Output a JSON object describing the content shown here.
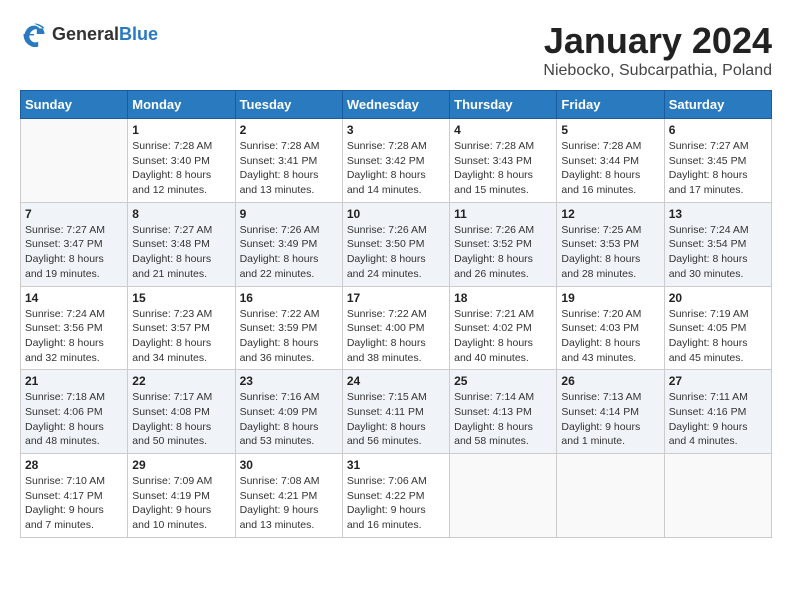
{
  "header": {
    "logo_general": "General",
    "logo_blue": "Blue",
    "month_title": "January 2024",
    "location": "Niebocko, Subcarpathia, Poland"
  },
  "weekdays": [
    "Sunday",
    "Monday",
    "Tuesday",
    "Wednesday",
    "Thursday",
    "Friday",
    "Saturday"
  ],
  "weeks": [
    [
      {
        "day": "",
        "info": ""
      },
      {
        "day": "1",
        "info": "Sunrise: 7:28 AM\nSunset: 3:40 PM\nDaylight: 8 hours\nand 12 minutes."
      },
      {
        "day": "2",
        "info": "Sunrise: 7:28 AM\nSunset: 3:41 PM\nDaylight: 8 hours\nand 13 minutes."
      },
      {
        "day": "3",
        "info": "Sunrise: 7:28 AM\nSunset: 3:42 PM\nDaylight: 8 hours\nand 14 minutes."
      },
      {
        "day": "4",
        "info": "Sunrise: 7:28 AM\nSunset: 3:43 PM\nDaylight: 8 hours\nand 15 minutes."
      },
      {
        "day": "5",
        "info": "Sunrise: 7:28 AM\nSunset: 3:44 PM\nDaylight: 8 hours\nand 16 minutes."
      },
      {
        "day": "6",
        "info": "Sunrise: 7:27 AM\nSunset: 3:45 PM\nDaylight: 8 hours\nand 17 minutes."
      }
    ],
    [
      {
        "day": "7",
        "info": "Sunrise: 7:27 AM\nSunset: 3:47 PM\nDaylight: 8 hours\nand 19 minutes."
      },
      {
        "day": "8",
        "info": "Sunrise: 7:27 AM\nSunset: 3:48 PM\nDaylight: 8 hours\nand 21 minutes."
      },
      {
        "day": "9",
        "info": "Sunrise: 7:26 AM\nSunset: 3:49 PM\nDaylight: 8 hours\nand 22 minutes."
      },
      {
        "day": "10",
        "info": "Sunrise: 7:26 AM\nSunset: 3:50 PM\nDaylight: 8 hours\nand 24 minutes."
      },
      {
        "day": "11",
        "info": "Sunrise: 7:26 AM\nSunset: 3:52 PM\nDaylight: 8 hours\nand 26 minutes."
      },
      {
        "day": "12",
        "info": "Sunrise: 7:25 AM\nSunset: 3:53 PM\nDaylight: 8 hours\nand 28 minutes."
      },
      {
        "day": "13",
        "info": "Sunrise: 7:24 AM\nSunset: 3:54 PM\nDaylight: 8 hours\nand 30 minutes."
      }
    ],
    [
      {
        "day": "14",
        "info": "Sunrise: 7:24 AM\nSunset: 3:56 PM\nDaylight: 8 hours\nand 32 minutes."
      },
      {
        "day": "15",
        "info": "Sunrise: 7:23 AM\nSunset: 3:57 PM\nDaylight: 8 hours\nand 34 minutes."
      },
      {
        "day": "16",
        "info": "Sunrise: 7:22 AM\nSunset: 3:59 PM\nDaylight: 8 hours\nand 36 minutes."
      },
      {
        "day": "17",
        "info": "Sunrise: 7:22 AM\nSunset: 4:00 PM\nDaylight: 8 hours\nand 38 minutes."
      },
      {
        "day": "18",
        "info": "Sunrise: 7:21 AM\nSunset: 4:02 PM\nDaylight: 8 hours\nand 40 minutes."
      },
      {
        "day": "19",
        "info": "Sunrise: 7:20 AM\nSunset: 4:03 PM\nDaylight: 8 hours\nand 43 minutes."
      },
      {
        "day": "20",
        "info": "Sunrise: 7:19 AM\nSunset: 4:05 PM\nDaylight: 8 hours\nand 45 minutes."
      }
    ],
    [
      {
        "day": "21",
        "info": "Sunrise: 7:18 AM\nSunset: 4:06 PM\nDaylight: 8 hours\nand 48 minutes."
      },
      {
        "day": "22",
        "info": "Sunrise: 7:17 AM\nSunset: 4:08 PM\nDaylight: 8 hours\nand 50 minutes."
      },
      {
        "day": "23",
        "info": "Sunrise: 7:16 AM\nSunset: 4:09 PM\nDaylight: 8 hours\nand 53 minutes."
      },
      {
        "day": "24",
        "info": "Sunrise: 7:15 AM\nSunset: 4:11 PM\nDaylight: 8 hours\nand 56 minutes."
      },
      {
        "day": "25",
        "info": "Sunrise: 7:14 AM\nSunset: 4:13 PM\nDaylight: 8 hours\nand 58 minutes."
      },
      {
        "day": "26",
        "info": "Sunrise: 7:13 AM\nSunset: 4:14 PM\nDaylight: 9 hours\nand 1 minute."
      },
      {
        "day": "27",
        "info": "Sunrise: 7:11 AM\nSunset: 4:16 PM\nDaylight: 9 hours\nand 4 minutes."
      }
    ],
    [
      {
        "day": "28",
        "info": "Sunrise: 7:10 AM\nSunset: 4:17 PM\nDaylight: 9 hours\nand 7 minutes."
      },
      {
        "day": "29",
        "info": "Sunrise: 7:09 AM\nSunset: 4:19 PM\nDaylight: 9 hours\nand 10 minutes."
      },
      {
        "day": "30",
        "info": "Sunrise: 7:08 AM\nSunset: 4:21 PM\nDaylight: 9 hours\nand 13 minutes."
      },
      {
        "day": "31",
        "info": "Sunrise: 7:06 AM\nSunset: 4:22 PM\nDaylight: 9 hours\nand 16 minutes."
      },
      {
        "day": "",
        "info": ""
      },
      {
        "day": "",
        "info": ""
      },
      {
        "day": "",
        "info": ""
      }
    ]
  ]
}
